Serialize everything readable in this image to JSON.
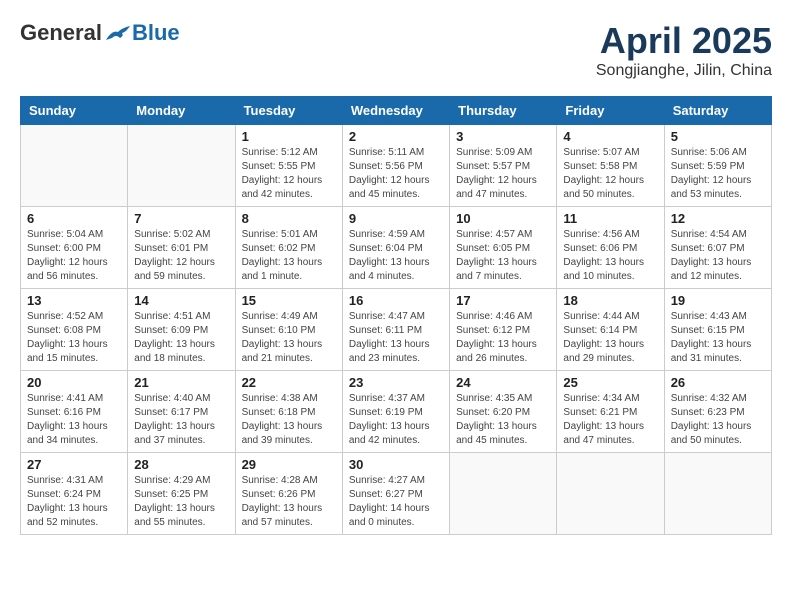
{
  "header": {
    "logo_general": "General",
    "logo_blue": "Blue",
    "title": "April 2025",
    "subtitle": "Songjianghe, Jilin, China"
  },
  "weekdays": [
    "Sunday",
    "Monday",
    "Tuesday",
    "Wednesday",
    "Thursday",
    "Friday",
    "Saturday"
  ],
  "weeks": [
    [
      {
        "day": "",
        "info": ""
      },
      {
        "day": "",
        "info": ""
      },
      {
        "day": "1",
        "info": "Sunrise: 5:12 AM\nSunset: 5:55 PM\nDaylight: 12 hours\nand 42 minutes."
      },
      {
        "day": "2",
        "info": "Sunrise: 5:11 AM\nSunset: 5:56 PM\nDaylight: 12 hours\nand 45 minutes."
      },
      {
        "day": "3",
        "info": "Sunrise: 5:09 AM\nSunset: 5:57 PM\nDaylight: 12 hours\nand 47 minutes."
      },
      {
        "day": "4",
        "info": "Sunrise: 5:07 AM\nSunset: 5:58 PM\nDaylight: 12 hours\nand 50 minutes."
      },
      {
        "day": "5",
        "info": "Sunrise: 5:06 AM\nSunset: 5:59 PM\nDaylight: 12 hours\nand 53 minutes."
      }
    ],
    [
      {
        "day": "6",
        "info": "Sunrise: 5:04 AM\nSunset: 6:00 PM\nDaylight: 12 hours\nand 56 minutes."
      },
      {
        "day": "7",
        "info": "Sunrise: 5:02 AM\nSunset: 6:01 PM\nDaylight: 12 hours\nand 59 minutes."
      },
      {
        "day": "8",
        "info": "Sunrise: 5:01 AM\nSunset: 6:02 PM\nDaylight: 13 hours\nand 1 minute."
      },
      {
        "day": "9",
        "info": "Sunrise: 4:59 AM\nSunset: 6:04 PM\nDaylight: 13 hours\nand 4 minutes."
      },
      {
        "day": "10",
        "info": "Sunrise: 4:57 AM\nSunset: 6:05 PM\nDaylight: 13 hours\nand 7 minutes."
      },
      {
        "day": "11",
        "info": "Sunrise: 4:56 AM\nSunset: 6:06 PM\nDaylight: 13 hours\nand 10 minutes."
      },
      {
        "day": "12",
        "info": "Sunrise: 4:54 AM\nSunset: 6:07 PM\nDaylight: 13 hours\nand 12 minutes."
      }
    ],
    [
      {
        "day": "13",
        "info": "Sunrise: 4:52 AM\nSunset: 6:08 PM\nDaylight: 13 hours\nand 15 minutes."
      },
      {
        "day": "14",
        "info": "Sunrise: 4:51 AM\nSunset: 6:09 PM\nDaylight: 13 hours\nand 18 minutes."
      },
      {
        "day": "15",
        "info": "Sunrise: 4:49 AM\nSunset: 6:10 PM\nDaylight: 13 hours\nand 21 minutes."
      },
      {
        "day": "16",
        "info": "Sunrise: 4:47 AM\nSunset: 6:11 PM\nDaylight: 13 hours\nand 23 minutes."
      },
      {
        "day": "17",
        "info": "Sunrise: 4:46 AM\nSunset: 6:12 PM\nDaylight: 13 hours\nand 26 minutes."
      },
      {
        "day": "18",
        "info": "Sunrise: 4:44 AM\nSunset: 6:14 PM\nDaylight: 13 hours\nand 29 minutes."
      },
      {
        "day": "19",
        "info": "Sunrise: 4:43 AM\nSunset: 6:15 PM\nDaylight: 13 hours\nand 31 minutes."
      }
    ],
    [
      {
        "day": "20",
        "info": "Sunrise: 4:41 AM\nSunset: 6:16 PM\nDaylight: 13 hours\nand 34 minutes."
      },
      {
        "day": "21",
        "info": "Sunrise: 4:40 AM\nSunset: 6:17 PM\nDaylight: 13 hours\nand 37 minutes."
      },
      {
        "day": "22",
        "info": "Sunrise: 4:38 AM\nSunset: 6:18 PM\nDaylight: 13 hours\nand 39 minutes."
      },
      {
        "day": "23",
        "info": "Sunrise: 4:37 AM\nSunset: 6:19 PM\nDaylight: 13 hours\nand 42 minutes."
      },
      {
        "day": "24",
        "info": "Sunrise: 4:35 AM\nSunset: 6:20 PM\nDaylight: 13 hours\nand 45 minutes."
      },
      {
        "day": "25",
        "info": "Sunrise: 4:34 AM\nSunset: 6:21 PM\nDaylight: 13 hours\nand 47 minutes."
      },
      {
        "day": "26",
        "info": "Sunrise: 4:32 AM\nSunset: 6:23 PM\nDaylight: 13 hours\nand 50 minutes."
      }
    ],
    [
      {
        "day": "27",
        "info": "Sunrise: 4:31 AM\nSunset: 6:24 PM\nDaylight: 13 hours\nand 52 minutes."
      },
      {
        "day": "28",
        "info": "Sunrise: 4:29 AM\nSunset: 6:25 PM\nDaylight: 13 hours\nand 55 minutes."
      },
      {
        "day": "29",
        "info": "Sunrise: 4:28 AM\nSunset: 6:26 PM\nDaylight: 13 hours\nand 57 minutes."
      },
      {
        "day": "30",
        "info": "Sunrise: 4:27 AM\nSunset: 6:27 PM\nDaylight: 14 hours\nand 0 minutes."
      },
      {
        "day": "",
        "info": ""
      },
      {
        "day": "",
        "info": ""
      },
      {
        "day": "",
        "info": ""
      }
    ]
  ]
}
